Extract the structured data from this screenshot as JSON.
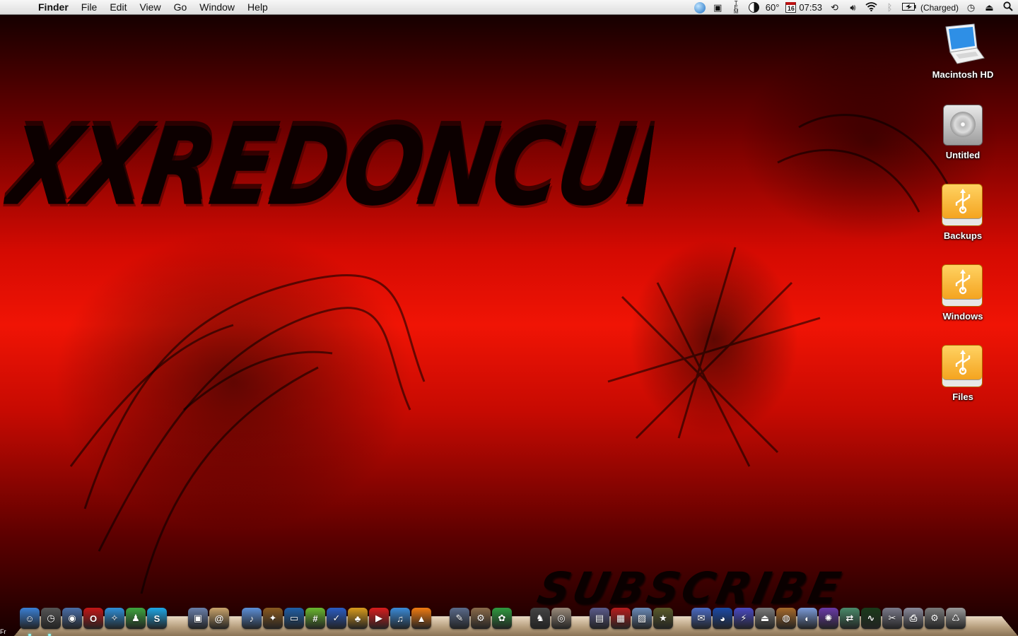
{
  "menubar": {
    "apple_glyph": "",
    "app_name": "Finder",
    "menus": [
      "File",
      "Edit",
      "View",
      "Go",
      "Window",
      "Help"
    ],
    "status": {
      "temperature": "60°",
      "calendar_day": "16",
      "clock": "07:53",
      "battery": "(Charged)",
      "icons": [
        "world-clock-icon",
        "app-status-icon",
        "tem-icon",
        "moon-phase-icon",
        "time-machine-icon",
        "volume-icon",
        "wifi-icon",
        "bluetooth-icon",
        "battery-icon",
        "sync-icon",
        "eject-icon",
        "spotlight-icon"
      ]
    }
  },
  "wallpaper": {
    "title": "XXREDONCULOSITYXX",
    "subscribe": "SUBSCRIBE",
    "colors": {
      "bright": "#f01405",
      "dark": "#150000"
    }
  },
  "desktop": {
    "icons": [
      {
        "label": "Macintosh HD",
        "type": "laptop-drive"
      },
      {
        "label": "Untitled",
        "type": "internal-disk"
      },
      {
        "label": "Backups",
        "type": "usb-drive"
      },
      {
        "label": "Windows",
        "type": "usb-drive"
      },
      {
        "label": "Files",
        "type": "usb-drive"
      }
    ]
  },
  "dock": {
    "apps": [
      {
        "name": "finder",
        "glyph": "☺",
        "color": "#3a7fd5"
      },
      {
        "name": "clock",
        "glyph": "◷",
        "color": "#555"
      },
      {
        "name": "network",
        "glyph": "◉",
        "color": "#4a6ea8"
      },
      {
        "name": "opera",
        "glyph": "O",
        "color": "#c41616"
      },
      {
        "name": "safari",
        "glyph": "✧",
        "color": "#2f8fd8"
      },
      {
        "name": "ichat",
        "glyph": "♟",
        "color": "#3fa63f"
      },
      {
        "name": "skype",
        "glyph": "S",
        "color": "#1ea7e6"
      },
      {
        "name": "preview",
        "glyph": "▣",
        "color": "#6a7faa"
      },
      {
        "name": "address-book",
        "glyph": "@",
        "color": "#c9a36a"
      },
      {
        "name": "itunes",
        "glyph": "♪",
        "color": "#5c8fd8"
      },
      {
        "name": "guitar",
        "glyph": "✦",
        "color": "#8a5a20"
      },
      {
        "name": "front-row",
        "glyph": "▭",
        "color": "#1f5fa8"
      },
      {
        "name": "chess",
        "glyph": "#",
        "color": "#6ab82f"
      },
      {
        "name": "twitter",
        "glyph": "✓",
        "color": "#2a5cc4"
      },
      {
        "name": "pineapple",
        "glyph": "♣",
        "color": "#d89a1c"
      },
      {
        "name": "youtube",
        "glyph": "▶",
        "color": "#d81c1c"
      },
      {
        "name": "music-note",
        "glyph": "♫",
        "color": "#3a8ad8"
      },
      {
        "name": "vlc",
        "glyph": "▲",
        "color": "#f07a10"
      },
      {
        "name": "pen-tool",
        "glyph": "✎",
        "color": "#5a6a8a"
      },
      {
        "name": "automator",
        "glyph": "⚙",
        "color": "#8a6a4a"
      },
      {
        "name": "plant",
        "glyph": "✿",
        "color": "#2f9a3f"
      },
      {
        "name": "spy",
        "glyph": "♞",
        "color": "#444"
      },
      {
        "name": "disc",
        "glyph": "◎",
        "color": "#9a8a7a"
      },
      {
        "name": "imovie",
        "glyph": "▤",
        "color": "#5a5a8a"
      },
      {
        "name": "photobooth",
        "glyph": "▦",
        "color": "#b81c1c"
      },
      {
        "name": "iphoto",
        "glyph": "▨",
        "color": "#6a8ab8"
      },
      {
        "name": "star",
        "glyph": "★",
        "color": "#5a5a2a"
      },
      {
        "name": "mail",
        "glyph": "✉",
        "color": "#4a6ac4"
      },
      {
        "name": "monster",
        "glyph": "◕",
        "color": "#1a4aa8"
      },
      {
        "name": "bolt",
        "glyph": "⚡",
        "color": "#4a4ac4"
      },
      {
        "name": "eject-app",
        "glyph": "⏏",
        "color": "#7a7a7a"
      },
      {
        "name": "pot",
        "glyph": "◍",
        "color": "#a86a2a"
      },
      {
        "name": "blender",
        "glyph": "◐",
        "color": "#7a9ad8"
      },
      {
        "name": "space",
        "glyph": "✺",
        "color": "#6a3aa8"
      },
      {
        "name": "migration",
        "glyph": "⇄",
        "color": "#4a8a6a"
      },
      {
        "name": "activity-monitor",
        "glyph": "∿",
        "color": "#1a3a1a"
      },
      {
        "name": "utility",
        "glyph": "✂",
        "color": "#7a7a8a"
      },
      {
        "name": "printer",
        "glyph": "⎙",
        "color": "#8a8a9a"
      },
      {
        "name": "preferences",
        "glyph": "⚙",
        "color": "#7a7a7a"
      },
      {
        "name": "trash",
        "glyph": "♺",
        "color": "#9a9a9a"
      }
    ]
  },
  "corner_fragment": "Fr"
}
